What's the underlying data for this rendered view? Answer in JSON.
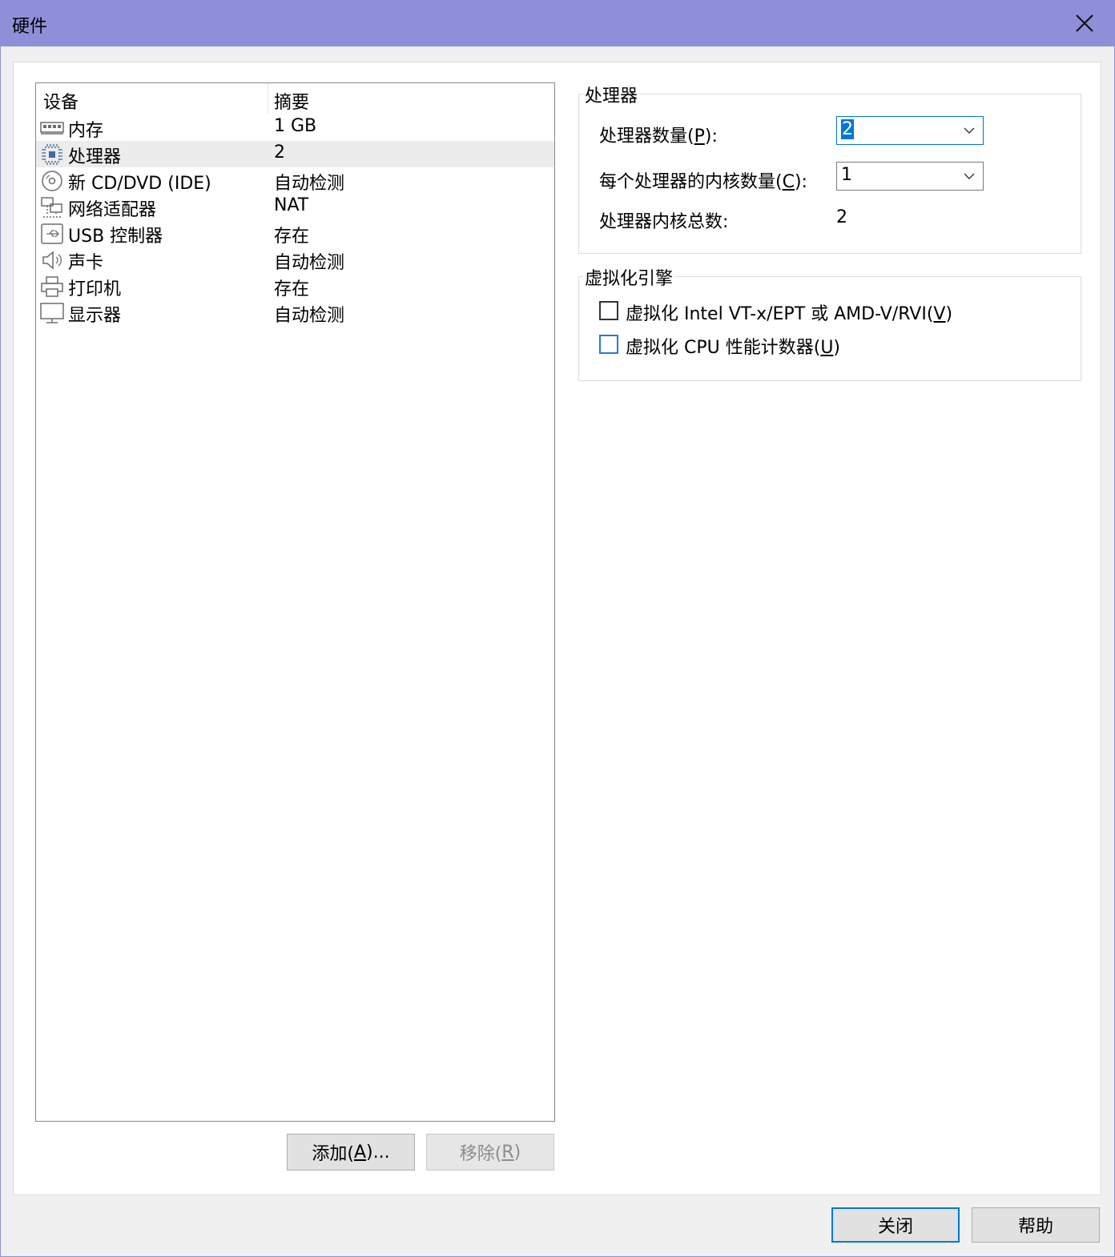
{
  "window": {
    "title": "硬件"
  },
  "device_list": {
    "columns": {
      "device": "设备",
      "summary": "摘要"
    },
    "rows": [
      {
        "icon": "memory-icon",
        "name": "内存",
        "summary": "1 GB"
      },
      {
        "icon": "processor-icon",
        "name": "处理器",
        "summary": "2",
        "selected": true
      },
      {
        "icon": "cd-dvd-icon",
        "name": "新 CD/DVD (IDE)",
        "summary": "自动检测"
      },
      {
        "icon": "network-icon",
        "name": "网络适配器",
        "summary": "NAT"
      },
      {
        "icon": "usb-icon",
        "name": "USB 控制器",
        "summary": "存在"
      },
      {
        "icon": "speaker-icon",
        "name": "声卡",
        "summary": "自动检测"
      },
      {
        "icon": "printer-icon",
        "name": "打印机",
        "summary": "存在"
      },
      {
        "icon": "monitor-icon",
        "name": "显示器",
        "summary": "自动检测"
      }
    ]
  },
  "list_buttons": {
    "add_pre": "添加(",
    "add_key": "A",
    "add_post": ")...",
    "remove_pre": "移除(",
    "remove_key": "R",
    "remove_post": ")"
  },
  "processor_group": {
    "title": "处理器",
    "count_label_pre": "处理器数量(",
    "count_label_key": "P",
    "count_label_post": "):",
    "count_value": "2",
    "cores_label_pre": "每个处理器的内核数量(",
    "cores_label_key": "C",
    "cores_label_post": "):",
    "cores_value": "1",
    "total_label": "处理器内核总数:",
    "total_value": "2"
  },
  "virt_group": {
    "title": "虚拟化引擎",
    "opt1_pre": "虚拟化 Intel VT-x/EPT 或 AMD-V/RVI(",
    "opt1_key": "V",
    "opt1_post": ")",
    "opt1_checked": false,
    "opt2_pre": "虚拟化 CPU 性能计数器(",
    "opt2_key": "U",
    "opt2_post": ")",
    "opt2_checked": false
  },
  "footer": {
    "close": "关闭",
    "help": "帮助"
  },
  "colors": {
    "titlebar": "#8f8fd9",
    "accent": "#0078d7"
  }
}
